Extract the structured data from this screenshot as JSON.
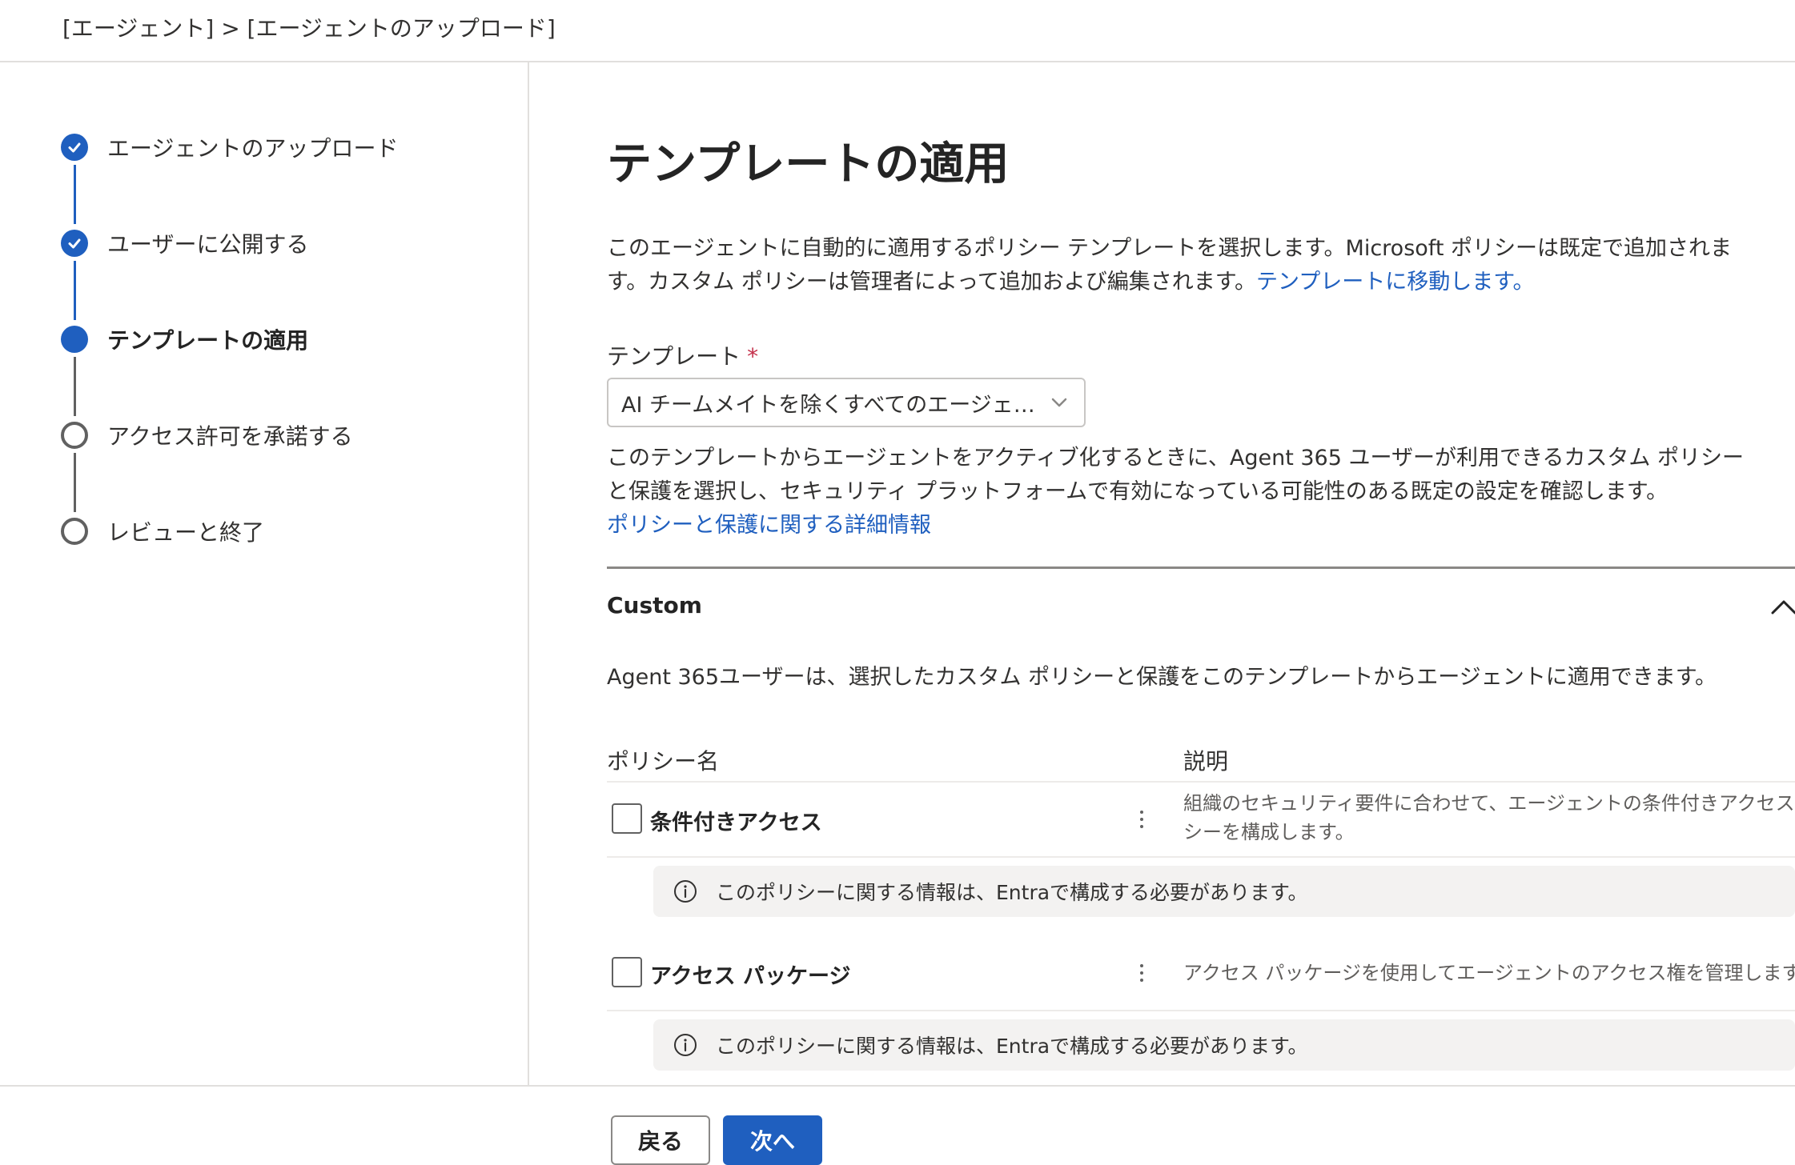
{
  "breadcrumb": "[エージェント] > [エージェントのアップロード]",
  "steps": [
    {
      "label": "エージェントのアップロード",
      "state": "done"
    },
    {
      "label": "ユーザーに公開する",
      "state": "done"
    },
    {
      "label": "テンプレートの適用",
      "state": "current"
    },
    {
      "label": "アクセス許可を承諾する",
      "state": "todo"
    },
    {
      "label": "レビューと終了",
      "state": "todo"
    }
  ],
  "main": {
    "title": "テンプレートの適用",
    "description": "このエージェントに自動的に適用するポリシー テンプレートを選択します。Microsoft ポリシーは既定で追加されます。カスタム ポリシーは管理者によって追加および編集されます。",
    "description_link": "テンプレートに移動します。",
    "template_label": "テンプレート",
    "required_mark": "*",
    "template_value": "AI チームメイトを除くすべてのエージェ…",
    "template_help": "このテンプレートからエージェントをアクティブ化するときに、Agent 365 ユーザーが利用できるカスタム ポリシーと保護を選択し、セキュリティ プラットフォームで有効になっている可能性のある既定の設定を確認します。",
    "template_help_link": "ポリシーと保護に関する詳細情報"
  },
  "section": {
    "title": "Custom",
    "description": "Agent 365ユーザーは、選択したカスタム ポリシーと保護をこのテンプレートからエージェントに適用できます。",
    "columns": {
      "name": "ポリシー名",
      "description": "説明"
    },
    "rows": [
      {
        "name": "条件付きアクセス",
        "description": "組織のセキュリティ要件に合わせて、エージェントの条件付きアクセス ポリ\nシーを構成します。",
        "info": "このポリシーに関する情報は、Entraで構成する必要があります。"
      },
      {
        "name": "アクセス パッケージ",
        "description": "アクセス パッケージを使用してエージェントのアクセス権を管理します。",
        "info": "このポリシーに関する情報は、Entraで構成する必要があります。"
      }
    ]
  },
  "footer": {
    "back_label": "戻る",
    "next_label": "次へ"
  },
  "colors": {
    "accent": "#1f5fbf",
    "required": "#c4314b",
    "info_bg": "#f3f2f1"
  },
  "icons": [
    "checkmark-icon",
    "chevron-down-icon",
    "chevron-up-icon",
    "info-icon",
    "more-vertical-icon"
  ]
}
